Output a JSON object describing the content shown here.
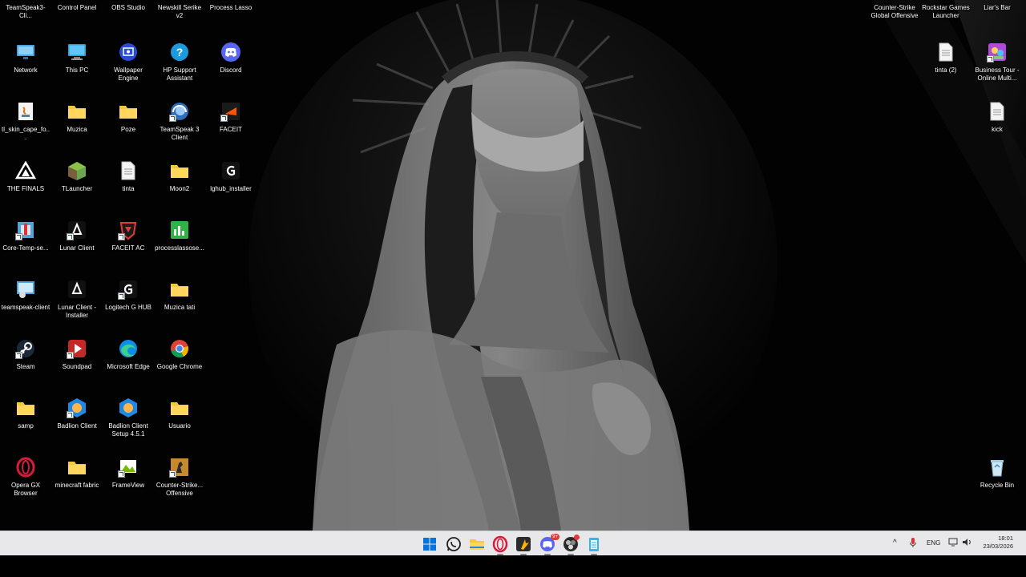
{
  "desktop": {
    "icons_col1": [
      "TeamSpeak3-Cli...",
      "Network",
      "tl_skin_cape_fo...",
      "THE FINALS",
      "Core-Temp-se...",
      "teamspeak-client",
      "Steam",
      "samp",
      "Opera GX Browser"
    ],
    "icons_col2": [
      "Control Panel",
      "This PC",
      "Muzica",
      "TLauncher",
      "Lunar Client",
      "Lunar Client - Installer",
      "Soundpad",
      "Badlion Client",
      "minecraft fabric"
    ],
    "icons_col3": [
      "OBS Studio",
      "Wallpaper Engine",
      "Poze",
      "tinta",
      "FACEIT AC",
      "Logitech G HUB",
      "Microsoft Edge",
      "Badlion Client Setup 4.5.1",
      "FrameView"
    ],
    "icons_col4": [
      "Newskill Serike v2",
      "HP Support Assistant",
      "TeamSpeak 3 Client",
      "Moon2",
      "processlassose...",
      "Muzica tati",
      "Google Chrome",
      "Usuario",
      "Counter-Strike... Offensive"
    ],
    "icons_col5": [
      "Process Lasso",
      "Discord",
      "FACEIT",
      "lghub_installer"
    ],
    "icons_right": [
      "Counter-Strike Global Offensive",
      "Rockstar Games Launcher",
      "Liar's Bar",
      "tinta (2)",
      "Business Tour - Online Multi...",
      "kick",
      "Recycle Bin"
    ]
  },
  "taskbar": {
    "apps": [
      "start-icon",
      "whatsapp-icon",
      "file-explorer-icon",
      "opera-gx-icon",
      "faceit-icon",
      "discord-icon",
      "obs-icon",
      "notepad-icon"
    ],
    "discord_badge": "9+",
    "tray": {
      "chevron": "^",
      "language": "ENG"
    },
    "clock": {
      "time": "18:01",
      "date": "23/03/2026"
    }
  },
  "colors": {
    "folder": "#f5c842",
    "taskbar": "#e8e8ea",
    "accent": "#1d5fc9"
  }
}
